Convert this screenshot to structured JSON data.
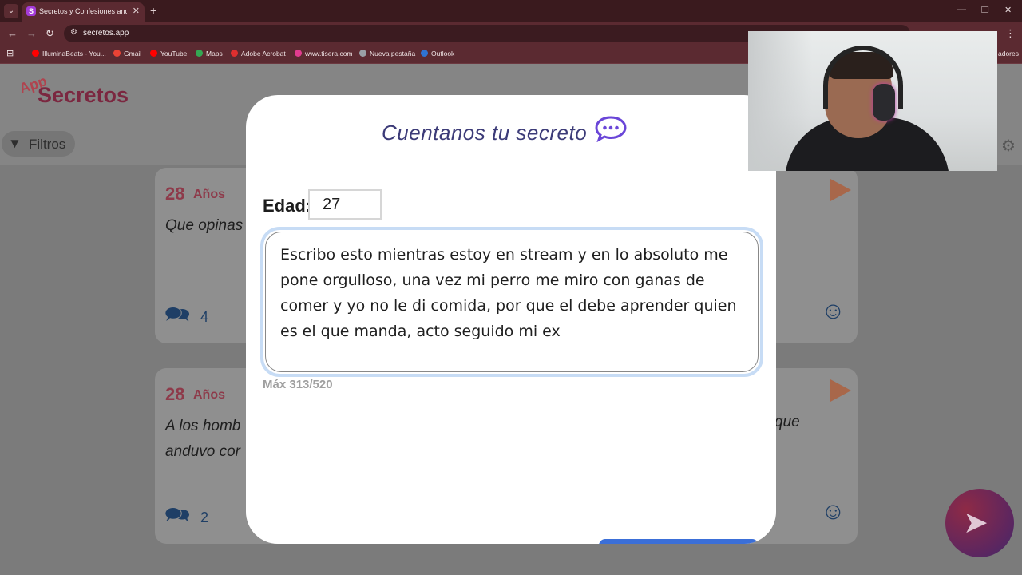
{
  "browser": {
    "tab_title": "Secretos y Confesiones anonim",
    "tab_favicon": "S",
    "url": "secretos.app",
    "bookmarks": [
      {
        "label": "IlluminaBeats - You...",
        "color": "#ff0000"
      },
      {
        "label": "Gmail",
        "color": "#ea4335"
      },
      {
        "label": "YouTube",
        "color": "#ff0000"
      },
      {
        "label": "Maps",
        "color": "#34a853"
      },
      {
        "label": "Adobe Acrobat",
        "color": "#e02f2f"
      },
      {
        "label": "www.tisera.com",
        "color": "#e23c8f"
      },
      {
        "label": "Nueva pestaña",
        "color": "#9aa0a6"
      },
      {
        "label": "Outlook",
        "color": "#2f73d3"
      }
    ],
    "bookmarks_overflow": "adores"
  },
  "app": {
    "logo_small": "App",
    "logo_main": "Secretos",
    "filters_label": "Filtros"
  },
  "cards": [
    {
      "age": "28",
      "age_word": "Años",
      "text": "Que opinas",
      "text_right": "",
      "comments": "4"
    },
    {
      "age": "28",
      "age_word": "Años",
      "text": "A los homb",
      "text_line2": "anduvo cor",
      "text_right": "que",
      "comments": "2"
    }
  ],
  "modal": {
    "title": "Cuentanos tu secreto",
    "age_label": "Edad:",
    "age_value": "27",
    "secret_text": "Escribo esto mientras estoy en stream y en lo absoluto me pone orgulloso, una vez mi perro me miro con ganas de comer y yo no le di comida, por que el debe aprender quien es el que manda, acto seguido mi ex ",
    "counter": "Máx 313/520"
  },
  "colors": {
    "accent": "#3c3b78",
    "brand": "#7b2740",
    "focus_ring": "#c7dcf5"
  }
}
